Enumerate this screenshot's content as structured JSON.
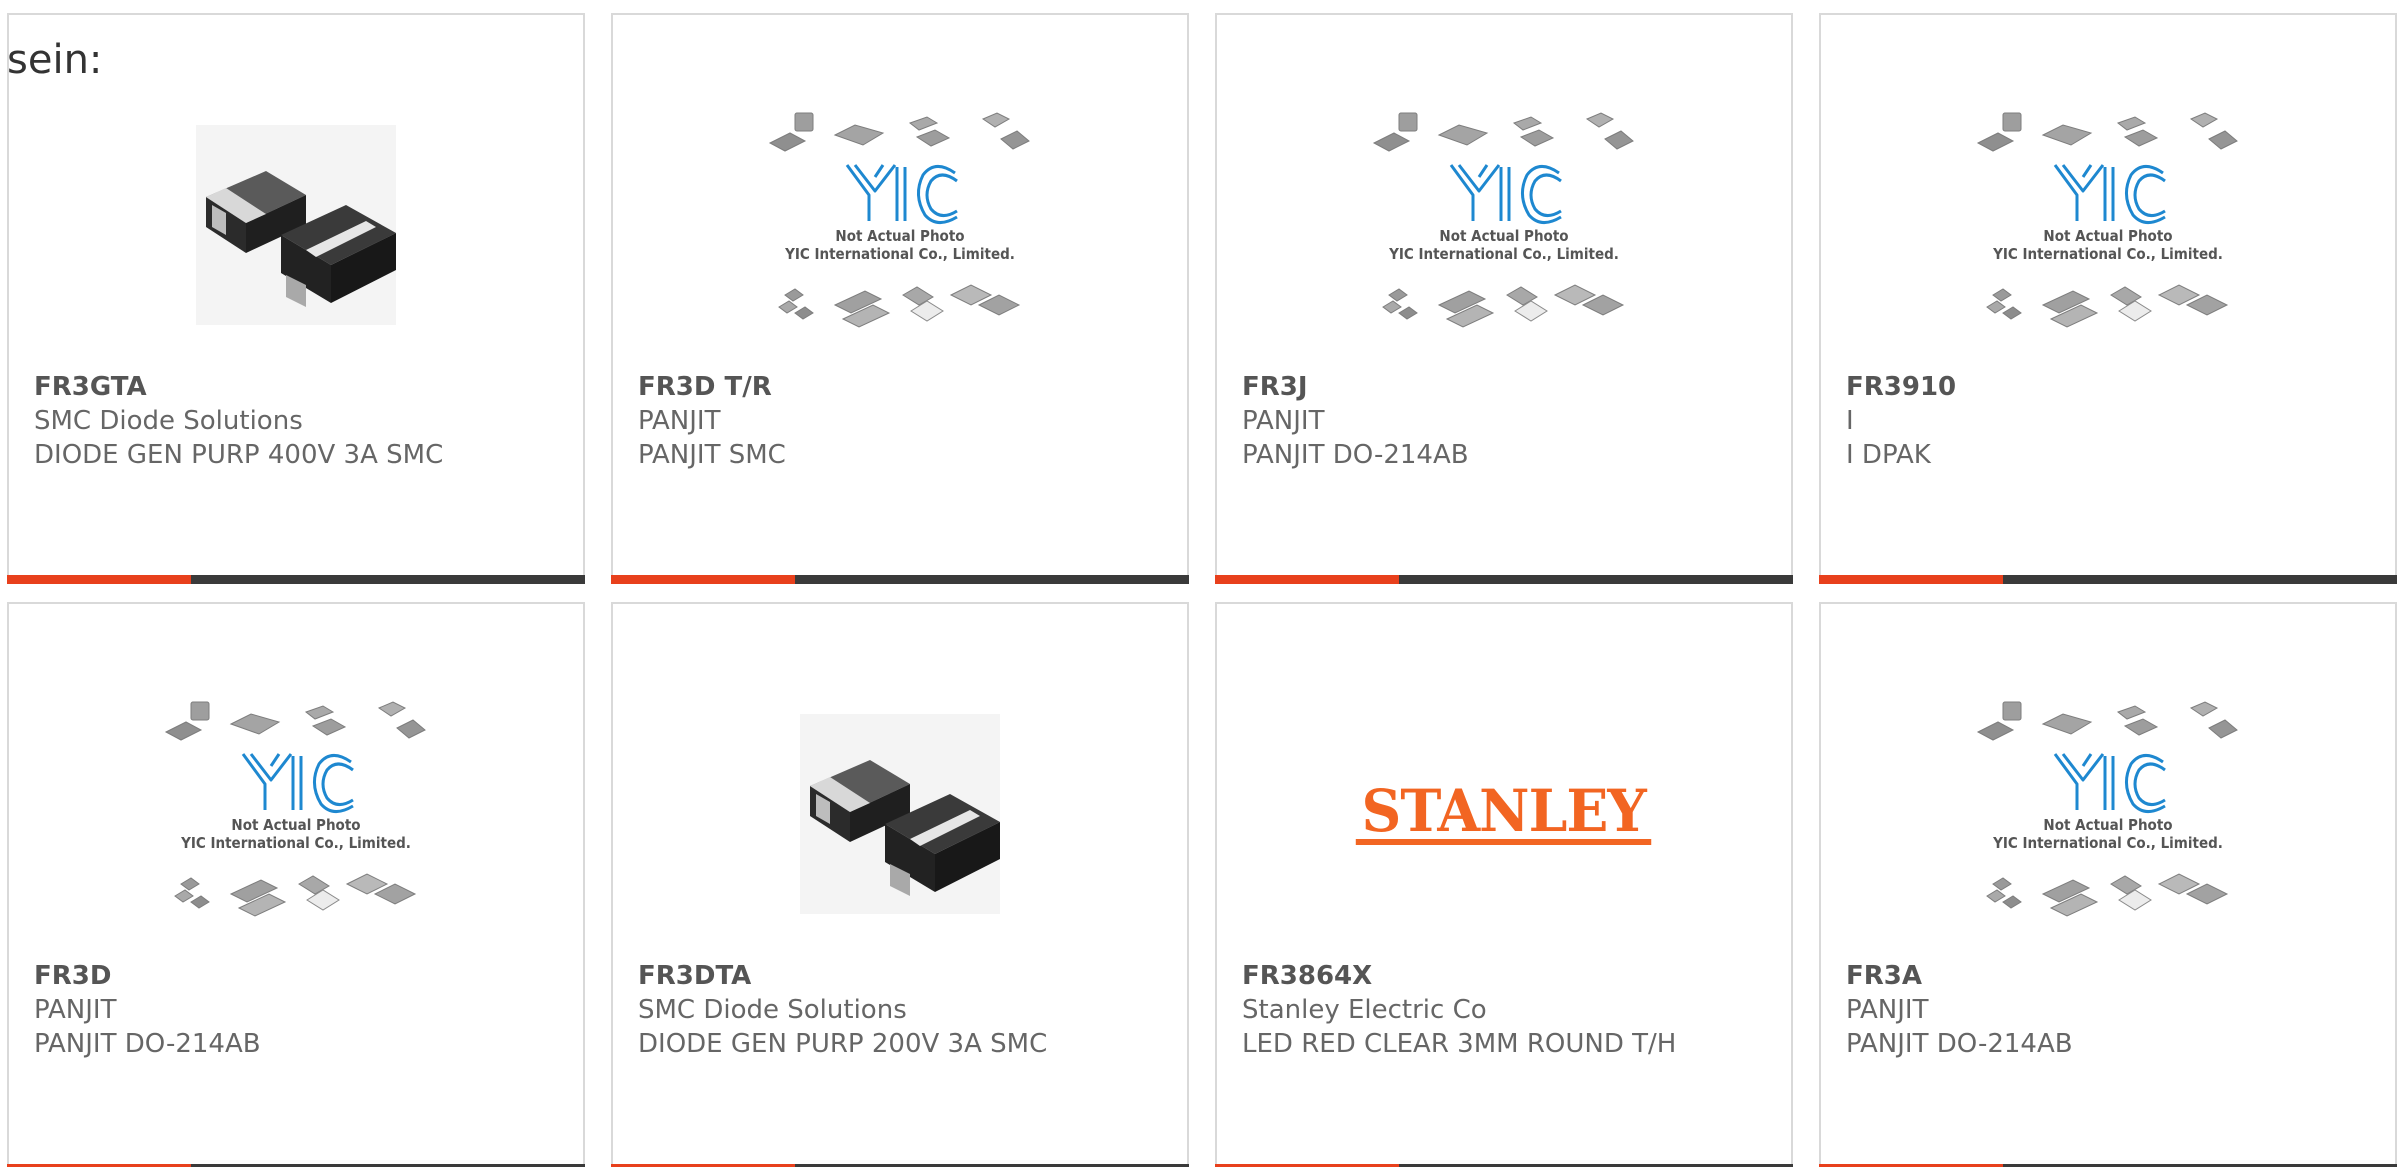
{
  "intro_text": "sein:",
  "colors": {
    "accent": "#e8401c",
    "bar_dark": "#3a3a3a",
    "border": "#d9d9d9",
    "stanley_orange": "#f26522",
    "yic_blue": "#1e88d0"
  },
  "placeholder_image": {
    "caption_line1": "Not Actual Photo",
    "caption_line2": "YIC International Co., Limited."
  },
  "logo_text": "STANLEY",
  "products": [
    {
      "part": "FR3GTA",
      "manufacturer": "SMC Diode Solutions",
      "description": "DIODE GEN PURP 400V 3A SMC",
      "image": "diode-photo"
    },
    {
      "part": "FR3D T/R",
      "manufacturer": "PANJIT",
      "description": "PANJIT SMC",
      "image": "yic-placeholder"
    },
    {
      "part": "FR3J",
      "manufacturer": "PANJIT",
      "description": "PANJIT DO-214AB",
      "image": "yic-placeholder"
    },
    {
      "part": "FR3910",
      "manufacturer": "I",
      "description": "I DPAK",
      "image": "yic-placeholder"
    },
    {
      "part": "FR3D",
      "manufacturer": "PANJIT",
      "description": "PANJIT DO-214AB",
      "image": "yic-placeholder"
    },
    {
      "part": "FR3DTA",
      "manufacturer": "SMC Diode Solutions",
      "description": "DIODE GEN PURP 200V 3A SMC",
      "image": "diode-photo"
    },
    {
      "part": "FR3864X",
      "manufacturer": "Stanley Electric Co",
      "description": "LED RED CLEAR 3MM ROUND T/H",
      "image": "stanley-logo"
    },
    {
      "part": "FR3A",
      "manufacturer": "PANJIT",
      "description": "PANJIT DO-214AB",
      "image": "yic-placeholder"
    }
  ]
}
